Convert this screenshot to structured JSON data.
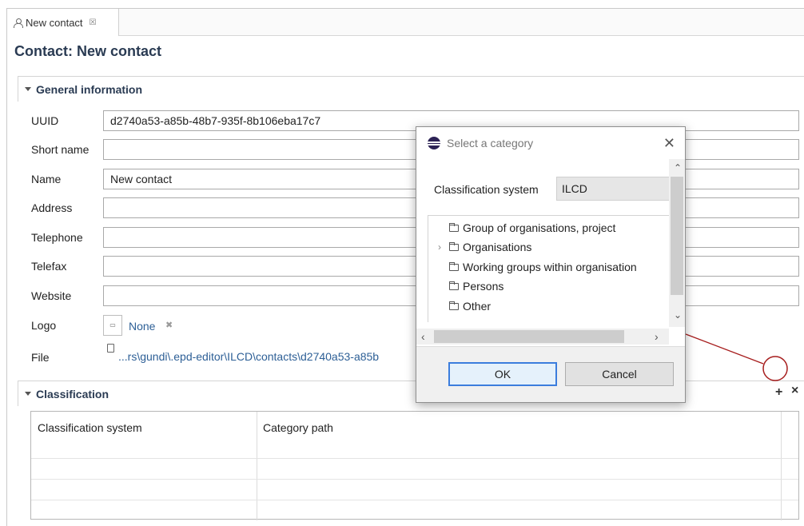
{
  "tab": {
    "label": "New contact",
    "close_glyph": "☒"
  },
  "page_title": "Contact: New contact",
  "general": {
    "header": "General information",
    "fields": [
      {
        "label": "UUID",
        "value": "d2740a53-a85b-48b7-935f-8b106eba17c7"
      },
      {
        "label": "Short name",
        "value": ""
      },
      {
        "label": "Name",
        "value": "New contact"
      },
      {
        "label": "Address",
        "value": ""
      },
      {
        "label": "Telephone",
        "value": ""
      },
      {
        "label": "Telefax",
        "value": ""
      },
      {
        "label": "Website",
        "value": ""
      }
    ],
    "logo": {
      "label": "Logo",
      "value": "None",
      "remove_glyph": "✖"
    },
    "file": {
      "label": "File",
      "value": "...rs\\gundi\\.epd-editor\\ILCD\\contacts\\d2740a53-a85b"
    }
  },
  "classification": {
    "header": "Classification",
    "add_glyph": "+",
    "remove_glyph": "×",
    "columns": [
      "Classification system",
      "Category path"
    ]
  },
  "dialog": {
    "title": "Select a category",
    "close_glyph": "✕",
    "system_label": "Classification system",
    "system_value": "ILCD",
    "tree": [
      {
        "label": "Group of organisations, project",
        "expandable": false
      },
      {
        "label": "Organisations",
        "expandable": true
      },
      {
        "label": "Working groups within organisation",
        "expandable": false
      },
      {
        "label": "Persons",
        "expandable": false
      },
      {
        "label": "Other",
        "expandable": false
      }
    ],
    "ok_label": "OK",
    "cancel_label": "Cancel"
  },
  "colors": {
    "title_text": "#2a3b53",
    "link": "#2d5f96",
    "annotation": "#a61c1c",
    "primary_button_border": "#3b7ddd"
  }
}
